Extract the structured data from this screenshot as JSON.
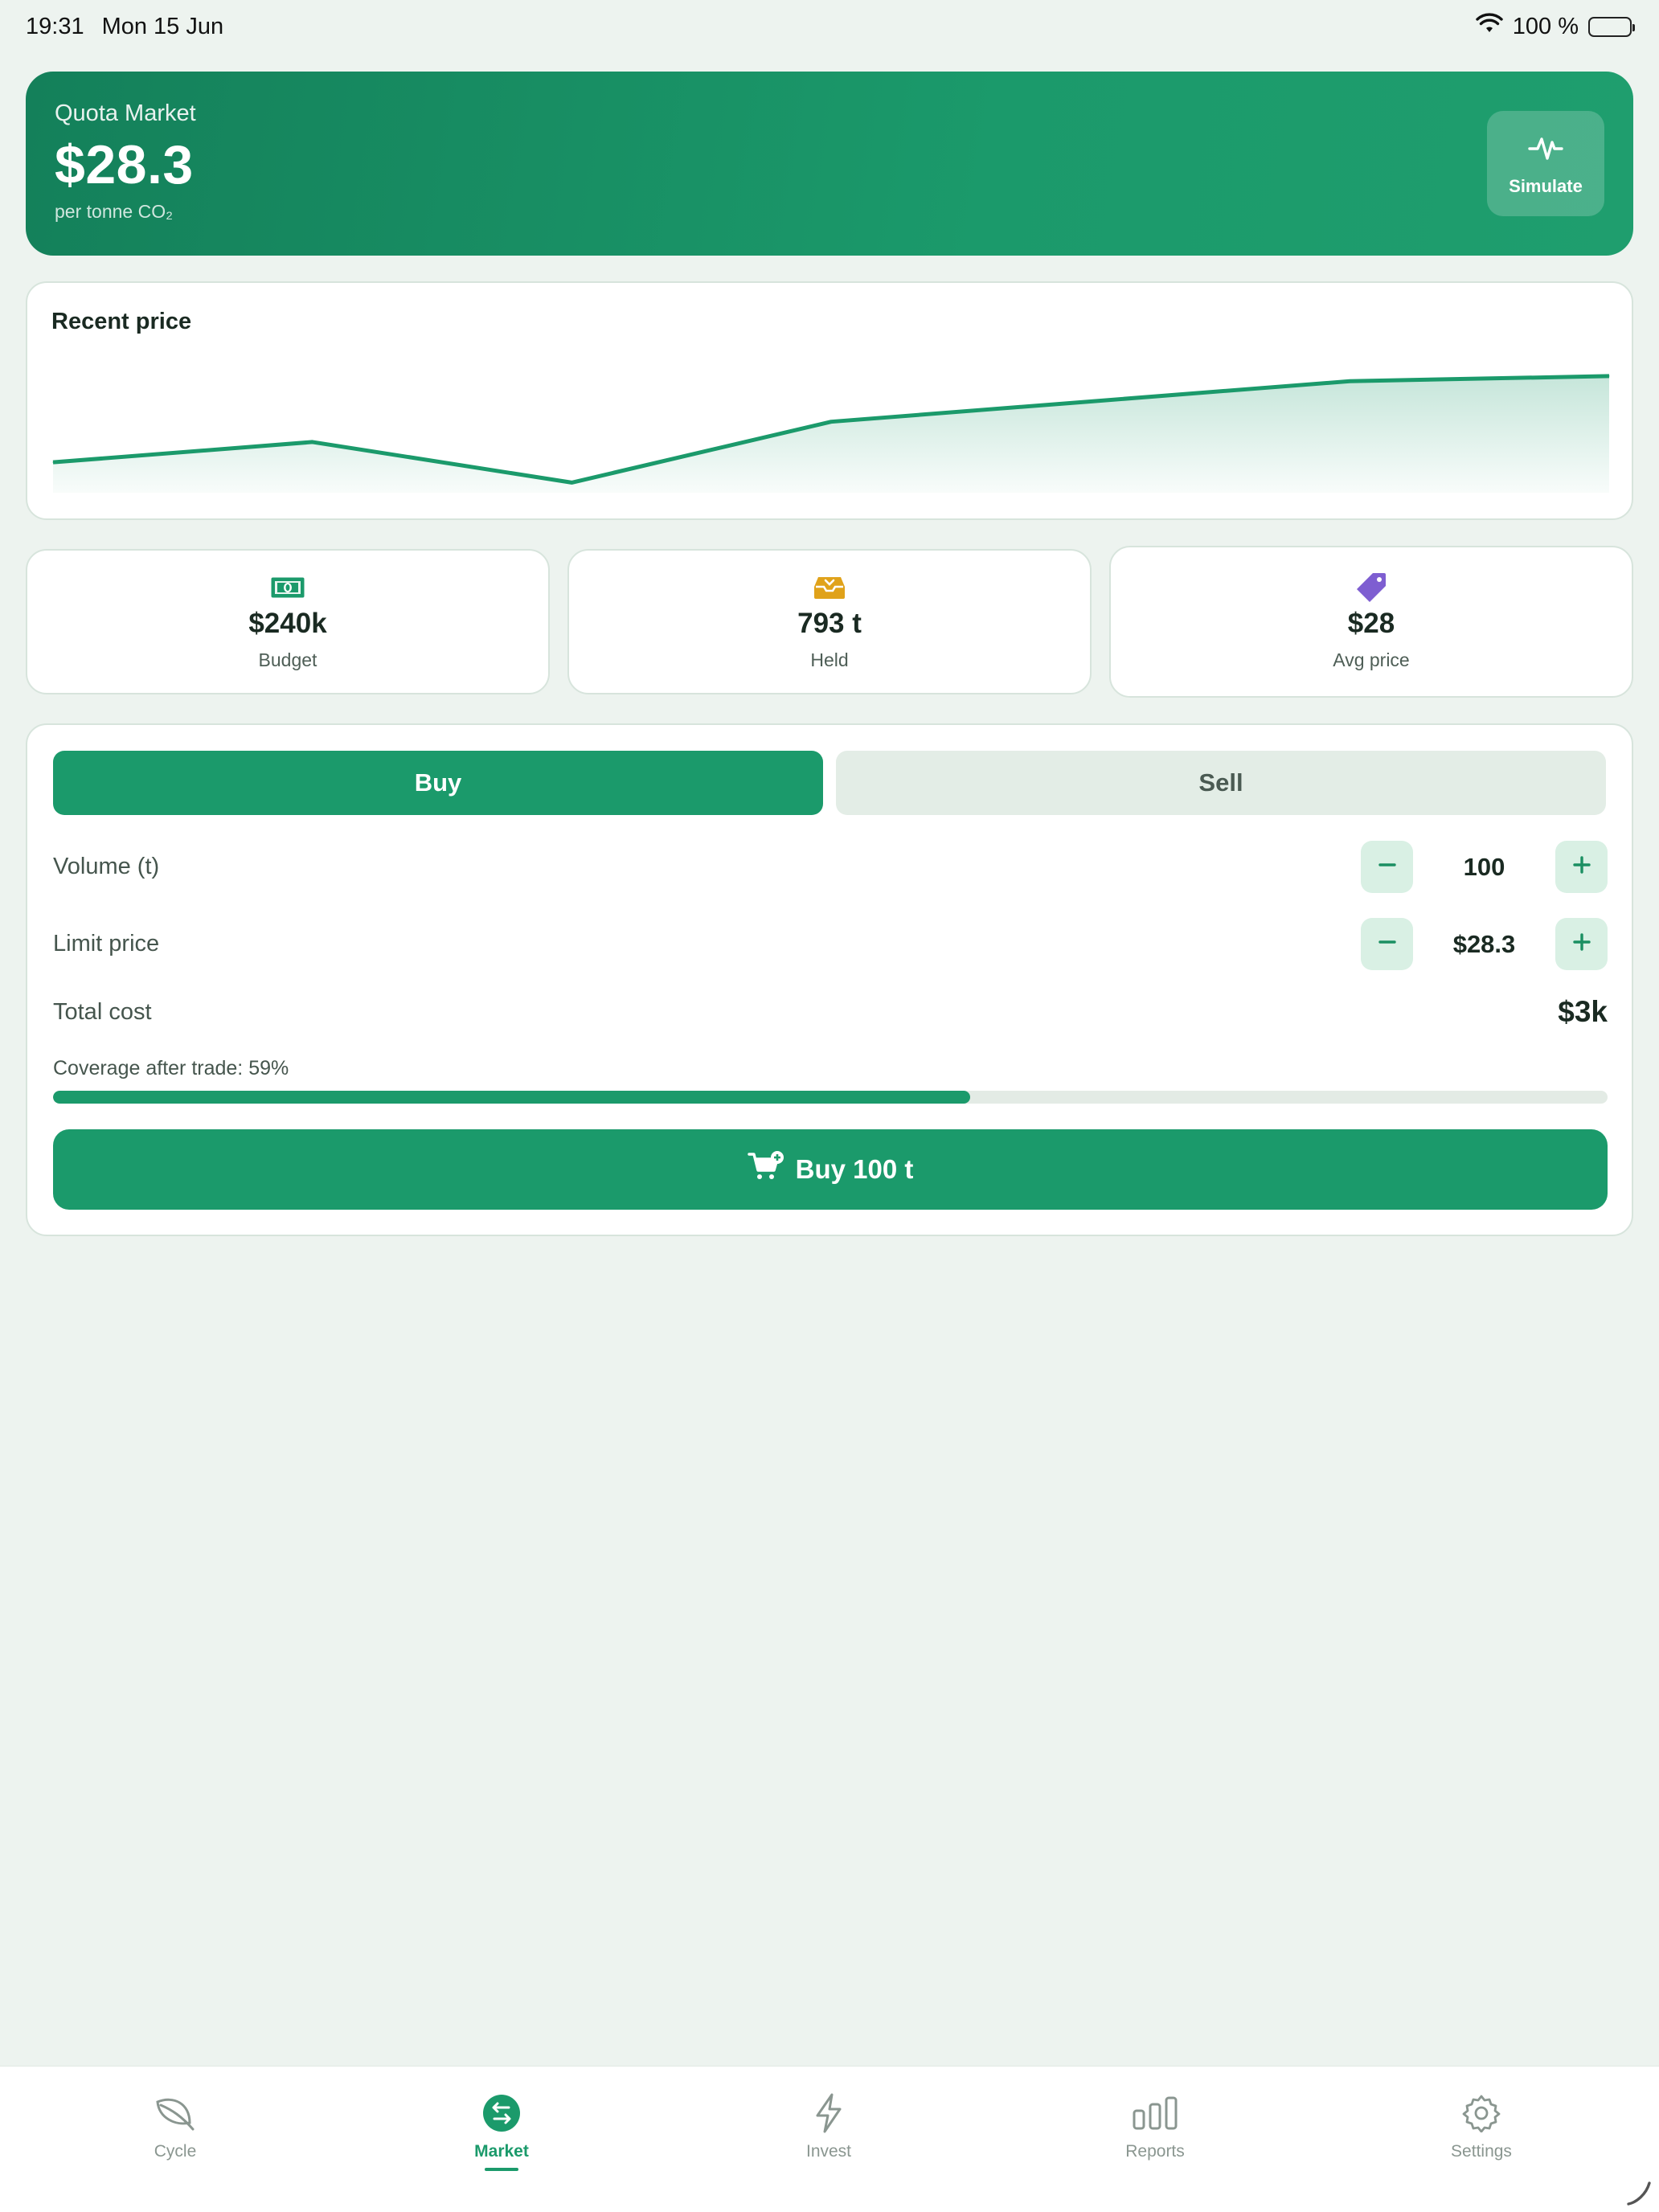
{
  "status_bar": {
    "time": "19:31",
    "date": "Mon 15 Jun",
    "battery": "100 %"
  },
  "header": {
    "label": "Quota Market",
    "price": "$28.3",
    "unit": "per tonne CO₂",
    "simulate_label": "Simulate",
    "simulate_icon": "pulse-icon"
  },
  "chart": {
    "title": "Recent price"
  },
  "chart_data": {
    "type": "area",
    "title": "Recent price",
    "x": [
      0,
      1,
      2,
      3,
      4,
      5,
      6
    ],
    "values": [
      28.0,
      28.2,
      27.8,
      28.4,
      28.6,
      28.8,
      28.85
    ],
    "ylim": [
      27.7,
      29.0
    ],
    "grid": false,
    "color": "#1b9a6b"
  },
  "stats": [
    {
      "value": "$240k",
      "label": "Budget",
      "icon": "banknote-icon",
      "color": "#1b9a6b"
    },
    {
      "value": "793 t",
      "label": "Held",
      "icon": "tray-icon",
      "color": "#e0a21a"
    },
    {
      "value": "$28",
      "label": "Avg price",
      "icon": "tag-icon",
      "color": "#7e5ed1"
    }
  ],
  "trade": {
    "buy_label": "Buy",
    "sell_label": "Sell",
    "volume_label": "Volume (t)",
    "volume_value": "100",
    "limit_label": "Limit price",
    "limit_value": "$28.3",
    "total_label": "Total cost",
    "total_value": "$3k",
    "coverage_label": "Coverage after trade: 59%",
    "coverage_fraction": 0.59,
    "submit_label": "Buy 100 t"
  },
  "tabs": [
    {
      "label": "Cycle",
      "icon": "leaf-icon"
    },
    {
      "label": "Market",
      "icon": "exchange-icon",
      "active": true
    },
    {
      "label": "Invest",
      "icon": "bolt-icon"
    },
    {
      "label": "Reports",
      "icon": "bar-chart-icon"
    },
    {
      "label": "Settings",
      "icon": "gear-icon"
    }
  ],
  "colors": {
    "accent": "#1b9a6b",
    "background": "#edf3ef"
  }
}
